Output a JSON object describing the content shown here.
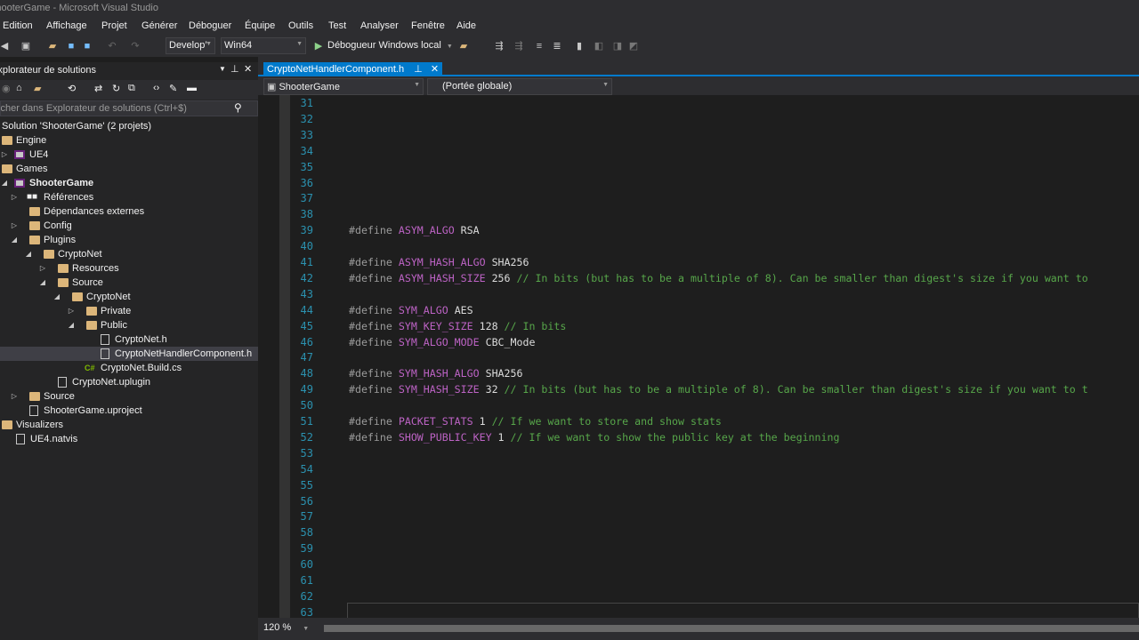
{
  "window": {
    "title": "ShooterGame - Microsoft Visual Studio"
  },
  "menu": [
    "Edition",
    "Affichage",
    "Projet",
    "Générer",
    "Déboguer",
    "Équipe",
    "Outils",
    "Test",
    "Analyser",
    "Fenêtre",
    "Aide"
  ],
  "toolbar": {
    "config": "Develop’",
    "platform": "Win64",
    "debugger": "Débogueur Windows local"
  },
  "solution_explorer": {
    "title": "Explorateur de solutions",
    "search_placeholder": "Rechercher dans Explorateur de solutions (Ctrl+$)",
    "items": [
      {
        "label": "Solution 'ShooterGame' (2 projets)",
        "icon": "solution-icon"
      },
      {
        "label": "Engine",
        "icon": "folder-icon"
      },
      {
        "label": "UE4",
        "icon": "project-icon"
      },
      {
        "label": "Games",
        "icon": "folder-icon"
      },
      {
        "label": "ShooterGame",
        "icon": "project-icon"
      },
      {
        "label": "Références",
        "icon": "references-icon"
      },
      {
        "label": "Dépendances externes",
        "icon": "folder-icon"
      },
      {
        "label": "Config",
        "icon": "folder-icon"
      },
      {
        "label": "Plugins",
        "icon": "folder-icon"
      },
      {
        "label": "CryptoNet",
        "icon": "folder-icon"
      },
      {
        "label": "Resources",
        "icon": "folder-icon"
      },
      {
        "label": "Source",
        "icon": "folder-icon"
      },
      {
        "label": "CryptoNet",
        "icon": "folder-icon"
      },
      {
        "label": "Private",
        "icon": "folder-icon"
      },
      {
        "label": "Public",
        "icon": "folder-icon"
      },
      {
        "label": "CryptoNet.h",
        "icon": "header-file-icon"
      },
      {
        "label": "CryptoNetHandlerComponent.h",
        "icon": "header-file-icon",
        "selected": true
      },
      {
        "label": "CryptoNet.Build.cs",
        "icon": "csharp-file-icon"
      },
      {
        "label": "CryptoNet.uplugin",
        "icon": "file-icon"
      },
      {
        "label": "Source",
        "icon": "folder-icon"
      },
      {
        "label": "ShooterGame.uproject",
        "icon": "file-icon"
      },
      {
        "label": "Visualizers",
        "icon": "folder-icon"
      },
      {
        "label": "UE4.natvis",
        "icon": "natvis-file-icon"
      }
    ]
  },
  "editor": {
    "tab": "CryptoNetHandlerComponent.h",
    "nav_project": "ShooterGame",
    "nav_scope": "(Portée globale)",
    "line_numbers": [
      "31",
      "32",
      "33",
      "34",
      "35",
      "36",
      "37",
      "38",
      "39",
      "40",
      "41",
      "42",
      "43",
      "44",
      "45",
      "46",
      "47",
      "48",
      "49",
      "50",
      "51",
      "52",
      "53",
      "54",
      "55",
      "56",
      "57",
      "58",
      "59",
      "60",
      "61",
      "62",
      "63"
    ],
    "lines": [
      {
        "n": "39",
        "kw": "#define",
        "mac": "ASYM_ALGO",
        "val": "RSA",
        "cm": ""
      },
      {
        "n": "41",
        "kw": "#define",
        "mac": "ASYM_HASH_ALGO",
        "val": "SHA256",
        "cm": ""
      },
      {
        "n": "42",
        "kw": "#define",
        "mac": "ASYM_HASH_SIZE",
        "val": "256",
        "cm": "// In bits (but has to be a multiple of 8). Can be smaller than digest's size if you want to"
      },
      {
        "n": "44",
        "kw": "#define",
        "mac": "SYM_ALGO",
        "val": "AES",
        "cm": ""
      },
      {
        "n": "45",
        "kw": "#define",
        "mac": "SYM_KEY_SIZE",
        "val": "128",
        "cm": "// In bits"
      },
      {
        "n": "46",
        "kw": "#define",
        "mac": "SYM_ALGO_MODE",
        "val": "CBC_Mode",
        "cm": ""
      },
      {
        "n": "48",
        "kw": "#define",
        "mac": "SYM_HASH_ALGO",
        "val": "SHA256",
        "cm": ""
      },
      {
        "n": "49",
        "kw": "#define",
        "mac": "SYM_HASH_SIZE",
        "val": "32",
        "cm": "// In bits (but has to be a multiple of 8). Can be smaller than digest's size if you want to t"
      },
      {
        "n": "51",
        "kw": "#define",
        "mac": "PACKET_STATS",
        "val": "1",
        "cm": "// If we want to store and show stats"
      },
      {
        "n": "52",
        "kw": "#define",
        "mac": "SHOW_PUBLIC_KEY",
        "val": "1",
        "cm": "// If we want to show the public key at the beginning"
      }
    ]
  },
  "status": {
    "zoom": "120 %"
  },
  "colors": {
    "accent": "#007acc",
    "macro": "#bd63c5",
    "comment": "#57a64a",
    "line_number": "#2b91af"
  }
}
